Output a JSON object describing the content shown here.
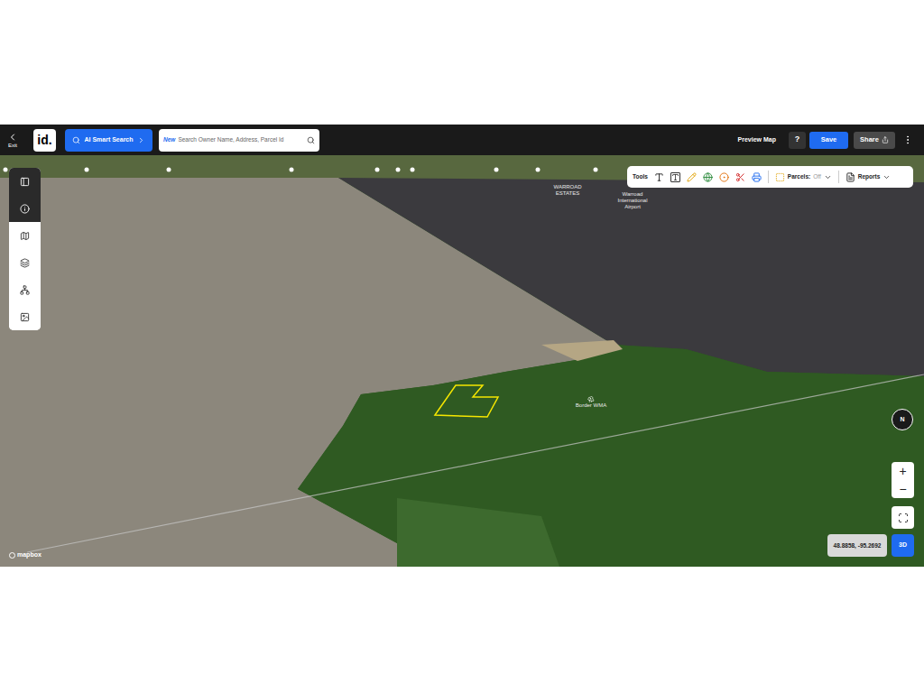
{
  "topbar": {
    "exit": "Exit",
    "logo": "id.",
    "ai_search": "AI Smart Search",
    "search": {
      "badge": "New",
      "placeholder": "Search Owner Name, Address, Parcel Id"
    },
    "preview": "Preview Map",
    "help": "?",
    "save": "Save",
    "share": "Share"
  },
  "side_tools": [
    {
      "selected": true
    },
    {
      "selected": true
    },
    {
      "selected": false
    },
    {
      "selected": false
    },
    {
      "selected": false
    },
    {
      "selected": false
    }
  ],
  "map_toolbar": {
    "label": "Tools",
    "parcels": "Parcels:",
    "parcels_value": "Off",
    "reports": "Reports"
  },
  "map_labels": [
    {
      "text": "WARROAD ESTATES"
    },
    {
      "text": "Warroad International Airport"
    },
    {
      "text": "Border WMA"
    }
  ],
  "controls": {
    "compass": "N",
    "zoom_in": "+",
    "zoom_out": "−",
    "coords": "48.8858, -95.2692",
    "view": "3D",
    "view_selected": true
  },
  "attribution": "mapbox"
}
